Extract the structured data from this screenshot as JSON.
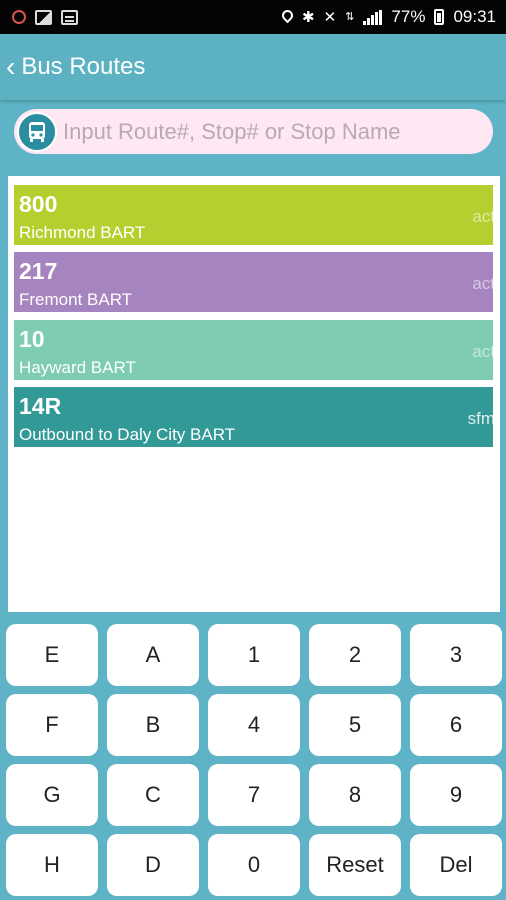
{
  "status_bar": {
    "battery": "77%",
    "time": "09:31",
    "left_icons": [
      "alarm-icon",
      "image-icon",
      "message-icon"
    ],
    "right_icons": [
      "location-icon",
      "bluetooth-icon",
      "mute-icon",
      "data-icon",
      "signal-icon",
      "battery-icon"
    ]
  },
  "app_bar": {
    "back_glyph": "‹",
    "title": "Bus Routes"
  },
  "search": {
    "placeholder": "Input Route#, Stop# or Stop Name",
    "value": ""
  },
  "routes": [
    {
      "number": "800",
      "name": "Richmond BART",
      "agency": "act",
      "color": "#b5cf2e"
    },
    {
      "number": "217",
      "name": "Fremont BART",
      "agency": "act",
      "color": "#a684bf"
    },
    {
      "number": "10",
      "name": "Hayward BART",
      "agency": "act",
      "color": "#7ecdb2"
    },
    {
      "number": "14R",
      "name": "Outbound to Daly City BART",
      "agency": "sfm",
      "color": "#329a96"
    }
  ],
  "keypad": {
    "rows": [
      [
        "E",
        "A",
        "1",
        "2",
        "3"
      ],
      [
        "F",
        "B",
        "4",
        "5",
        "6"
      ],
      [
        "G",
        "C",
        "7",
        "8",
        "9"
      ],
      [
        "H",
        "D",
        "0",
        "Reset",
        "Del"
      ]
    ]
  },
  "colors": {
    "accent": "#5cb2c3",
    "keypad_bg": "#5eb4c6",
    "search_bg": "#fde8f4"
  }
}
